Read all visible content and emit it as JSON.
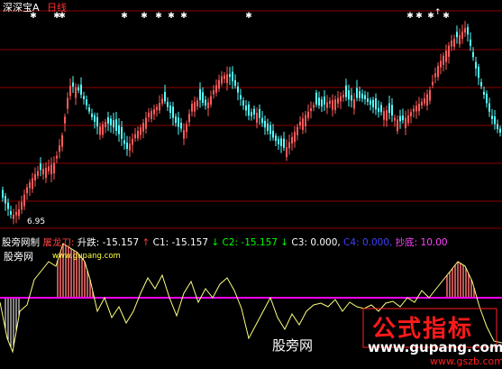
{
  "header": {
    "stock_name": "深深宝A",
    "period": "日线"
  },
  "price_panel": {
    "low_label": "6.95",
    "colors": {
      "up": "#ff5a5a",
      "down": "#54ffff",
      "grid": "#8b0000",
      "background": "#000000"
    },
    "arrow_text": "↑"
  },
  "indicator_bar": {
    "name": "股旁网制",
    "items": [
      {
        "label": "屠龙刀:",
        "color": "#ff4040"
      },
      {
        "label": "升跌: -15.157",
        "color": "#ffffff"
      },
      {
        "label": "↑",
        "color": "#ff4040"
      },
      {
        "label": "C1: -15.157",
        "color": "#ffffff"
      },
      {
        "label": "↓",
        "color": "#00ff00"
      },
      {
        "label": "C2: -15.157",
        "color": "#00ff00"
      },
      {
        "label": "↓",
        "color": "#00ff00"
      },
      {
        "label": "C3: 0.000,",
        "color": "#ffffff"
      },
      {
        "label": "C4: 0.000,",
        "color": "#4040ff"
      },
      {
        "label": "抄底: 10.00",
        "color": "#ff44ff"
      }
    ]
  },
  "watermarks": {
    "site_top": "股旁网",
    "url_top": "www.gupang.com",
    "site_bottom": "股旁网",
    "url_bottom": "www.gupang.com",
    "formula": "公式指标",
    "url_gszb": "www.gszb.com"
  },
  "indicator_colors": {
    "line": "#ffff80",
    "baseline": "#ff00ff",
    "bars": "#ff7070"
  }
}
